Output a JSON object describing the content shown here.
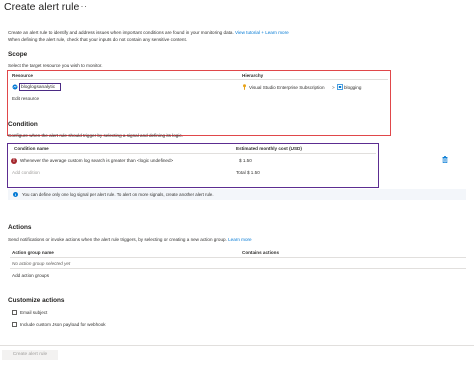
{
  "page": {
    "title": "Create alert rule",
    "menu_label": "···",
    "description_line1": "Create an alert rule to identify and address issues when important conditions are found in your monitoring data.",
    "learn_more_link": "View tutorial + Learn more",
    "description_line2": "When defining the alert rule, check that your inputs do not contain any sensitive content."
  },
  "scope": {
    "heading": "Scope",
    "subtitle": "Select the target resource you wish to monitor.",
    "col_resource": "Resource",
    "col_hierarchy": "Hierarchy",
    "resource_name": "bloglogsanalytic",
    "subscription": "Visual Studio Enterprise Subscription",
    "separator": ">",
    "resource_group": "blogging",
    "edit_link": "Edit resource"
  },
  "condition": {
    "heading": "Condition",
    "subtitle": "Configure when the alert rule should trigger by selecting a signal and defining its logic.",
    "col_name": "Condition name",
    "col_cost": "Estimated monthly cost (USD)",
    "condition_text": "Whenever the average custom log search is greater than <logic undefined>",
    "condition_cost": "$ 1.50",
    "add_condition": "Add condition",
    "total": "Total $ 1.50",
    "info_message": "You can define only one log signal per alert rule. To alert on more signals, create another alert rule."
  },
  "actions": {
    "heading": "Actions",
    "subtitle": "Send notifications or invoke actions when the alert rule triggers, by selecting or creating a new action group.",
    "learn_more": "Learn more",
    "col_group": "Action group name",
    "col_actions": "Contains actions",
    "empty_text": "No action group selected yet",
    "add_groups": "Add action groups"
  },
  "custom": {
    "heading": "Customize actions",
    "email_subject": "Email subject",
    "custom_json": "Include custom Json payload for webhook"
  },
  "footer": {
    "create_button": "Create alert rule"
  },
  "colors": {
    "accent": "#0078d4",
    "error": "#a4262c",
    "highlight_red": "#e0474a",
    "highlight_purple": "#5c2d91"
  },
  "icons": {
    "resource": "log-analytics-icon",
    "subscription": "key-icon",
    "resource_group": "resource-group-icon",
    "error": "error-icon",
    "delete": "trash-icon",
    "info": "info-icon"
  }
}
